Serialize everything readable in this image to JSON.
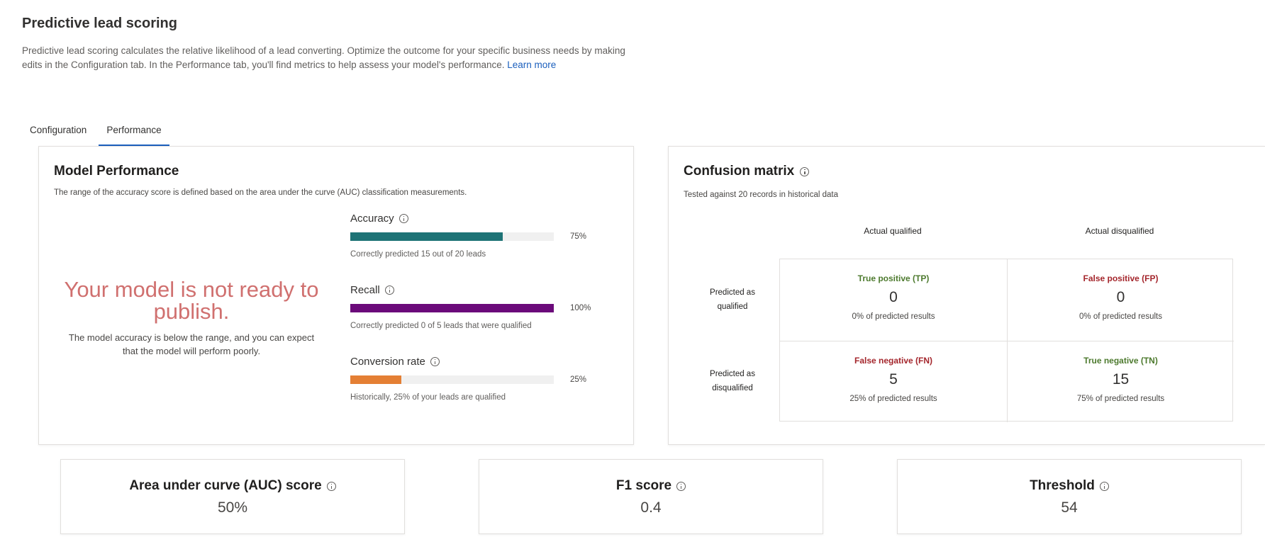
{
  "page": {
    "title": "Predictive lead scoring",
    "description": "Predictive lead scoring calculates the relative likelihood of a lead converting. Optimize the outcome for your specific business needs by making edits in the Configuration tab. In the Performance tab, you'll find metrics to help assess your model's performance.",
    "learn_more": "Learn more"
  },
  "tabs": [
    {
      "label": "Configuration",
      "active": false
    },
    {
      "label": "Performance",
      "active": true
    }
  ],
  "model_performance": {
    "title": "Model Performance",
    "subtitle": "The range of the accuracy score is defined based on the area under the curve (AUC) classification measurements.",
    "status_title": "Your model is not ready to publish.",
    "status_desc": "The model accuracy is below the range, and you can expect that the model will perform poorly.",
    "metrics": [
      {
        "name": "Accuracy",
        "value": 0.75,
        "pct_label": "75%",
        "color": "#1e7376",
        "note": "Correctly predicted 15 out of 20 leads"
      },
      {
        "name": "Recall",
        "value": 1.0,
        "pct_label": "100%",
        "color": "#6b0a7a",
        "note": "Correctly predicted 0 of 5 leads that were qualified"
      },
      {
        "name": "Conversion rate",
        "value": 0.25,
        "pct_label": "25%",
        "color": "#e47f34",
        "note": "Historically, 25% of your leads are qualified"
      }
    ]
  },
  "confusion_matrix": {
    "title": "Confusion matrix",
    "subtitle": "Tested against 20 records in historical data",
    "col_heads": [
      "Actual qualified",
      "Actual disqualified"
    ],
    "row_heads": [
      "Predicted as qualified",
      "Predicted as disqualified"
    ],
    "cells": [
      {
        "label": "True positive (TP)",
        "value": "0",
        "note": "0% of predicted results",
        "kind": "good"
      },
      {
        "label": "False positive (FP)",
        "value": "0",
        "note": "0% of predicted results",
        "kind": "bad"
      },
      {
        "label": "False negative (FN)",
        "value": "5",
        "note": "25% of predicted results",
        "kind": "bad"
      },
      {
        "label": "True negative (TN)",
        "value": "15",
        "note": "75% of predicted results",
        "kind": "good"
      }
    ]
  },
  "stats": [
    {
      "name": "Area under curve (AUC) score",
      "value": "50%"
    },
    {
      "name": "F1 score",
      "value": "0.4"
    },
    {
      "name": "Threshold",
      "value": "54"
    }
  ]
}
